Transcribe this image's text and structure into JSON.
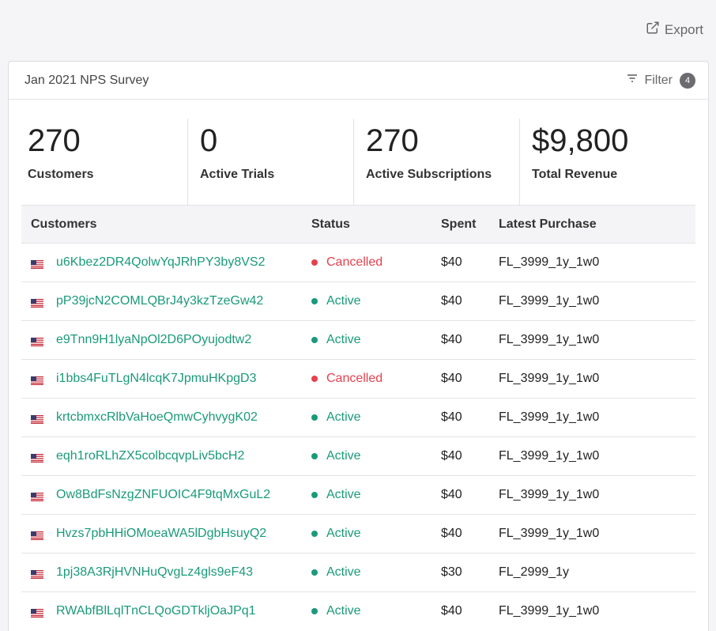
{
  "toolbar": {
    "export_label": "Export"
  },
  "card": {
    "title": "Jan 2021 NPS Survey",
    "filter_label": "Filter",
    "filter_count": "4"
  },
  "stats": [
    {
      "value": "270",
      "label": "Customers"
    },
    {
      "value": "0",
      "label": "Active Trials"
    },
    {
      "value": "270",
      "label": "Active Subscriptions"
    },
    {
      "value": "$9,800",
      "label": "Total Revenue"
    }
  ],
  "table": {
    "headers": [
      "Customers",
      "Status",
      "Spent",
      "Latest Purchase"
    ],
    "rows": [
      {
        "customer": "u6Kbez2DR4QolwYqJRhPY3by8VS2",
        "status": "Cancelled",
        "spent": "$40",
        "purchase": "FL_3999_1y_1w0"
      },
      {
        "customer": "pP39jcN2COMLQBrJ4y3kzTzeGw42",
        "status": "Active",
        "spent": "$40",
        "purchase": "FL_3999_1y_1w0"
      },
      {
        "customer": "e9Tnn9H1lyaNpOl2D6POyujodtw2",
        "status": "Active",
        "spent": "$40",
        "purchase": "FL_3999_1y_1w0"
      },
      {
        "customer": "i1bbs4FuTLgN4lcqK7JpmuHKpgD3",
        "status": "Cancelled",
        "spent": "$40",
        "purchase": "FL_3999_1y_1w0"
      },
      {
        "customer": "krtcbmxcRlbVaHoeQmwCyhvygK02",
        "status": "Active",
        "spent": "$40",
        "purchase": "FL_3999_1y_1w0"
      },
      {
        "customer": "eqh1roRLhZX5colbcqvpLiv5bcH2",
        "status": "Active",
        "spent": "$40",
        "purchase": "FL_3999_1y_1w0"
      },
      {
        "customer": "Ow8BdFsNzgZNFUOIC4F9tqMxGuL2",
        "status": "Active",
        "spent": "$40",
        "purchase": "FL_3999_1y_1w0"
      },
      {
        "customer": "Hvzs7pbHHiOMoeaWA5lDgbHsuyQ2",
        "status": "Active",
        "spent": "$40",
        "purchase": "FL_3999_1y_1w0"
      },
      {
        "customer": "1pj38A3RjHVNHuQvgLz4gls9eF43",
        "status": "Active",
        "spent": "$30",
        "purchase": "FL_2999_1y"
      },
      {
        "customer": "RWAbfBlLqlTnCLQoGDTkljOaJPq1",
        "status": "Active",
        "spent": "$40",
        "purchase": "FL_3999_1y_1w0"
      }
    ]
  },
  "colors": {
    "accent": "#1a9a7a",
    "cancelled": "#e4424d"
  }
}
